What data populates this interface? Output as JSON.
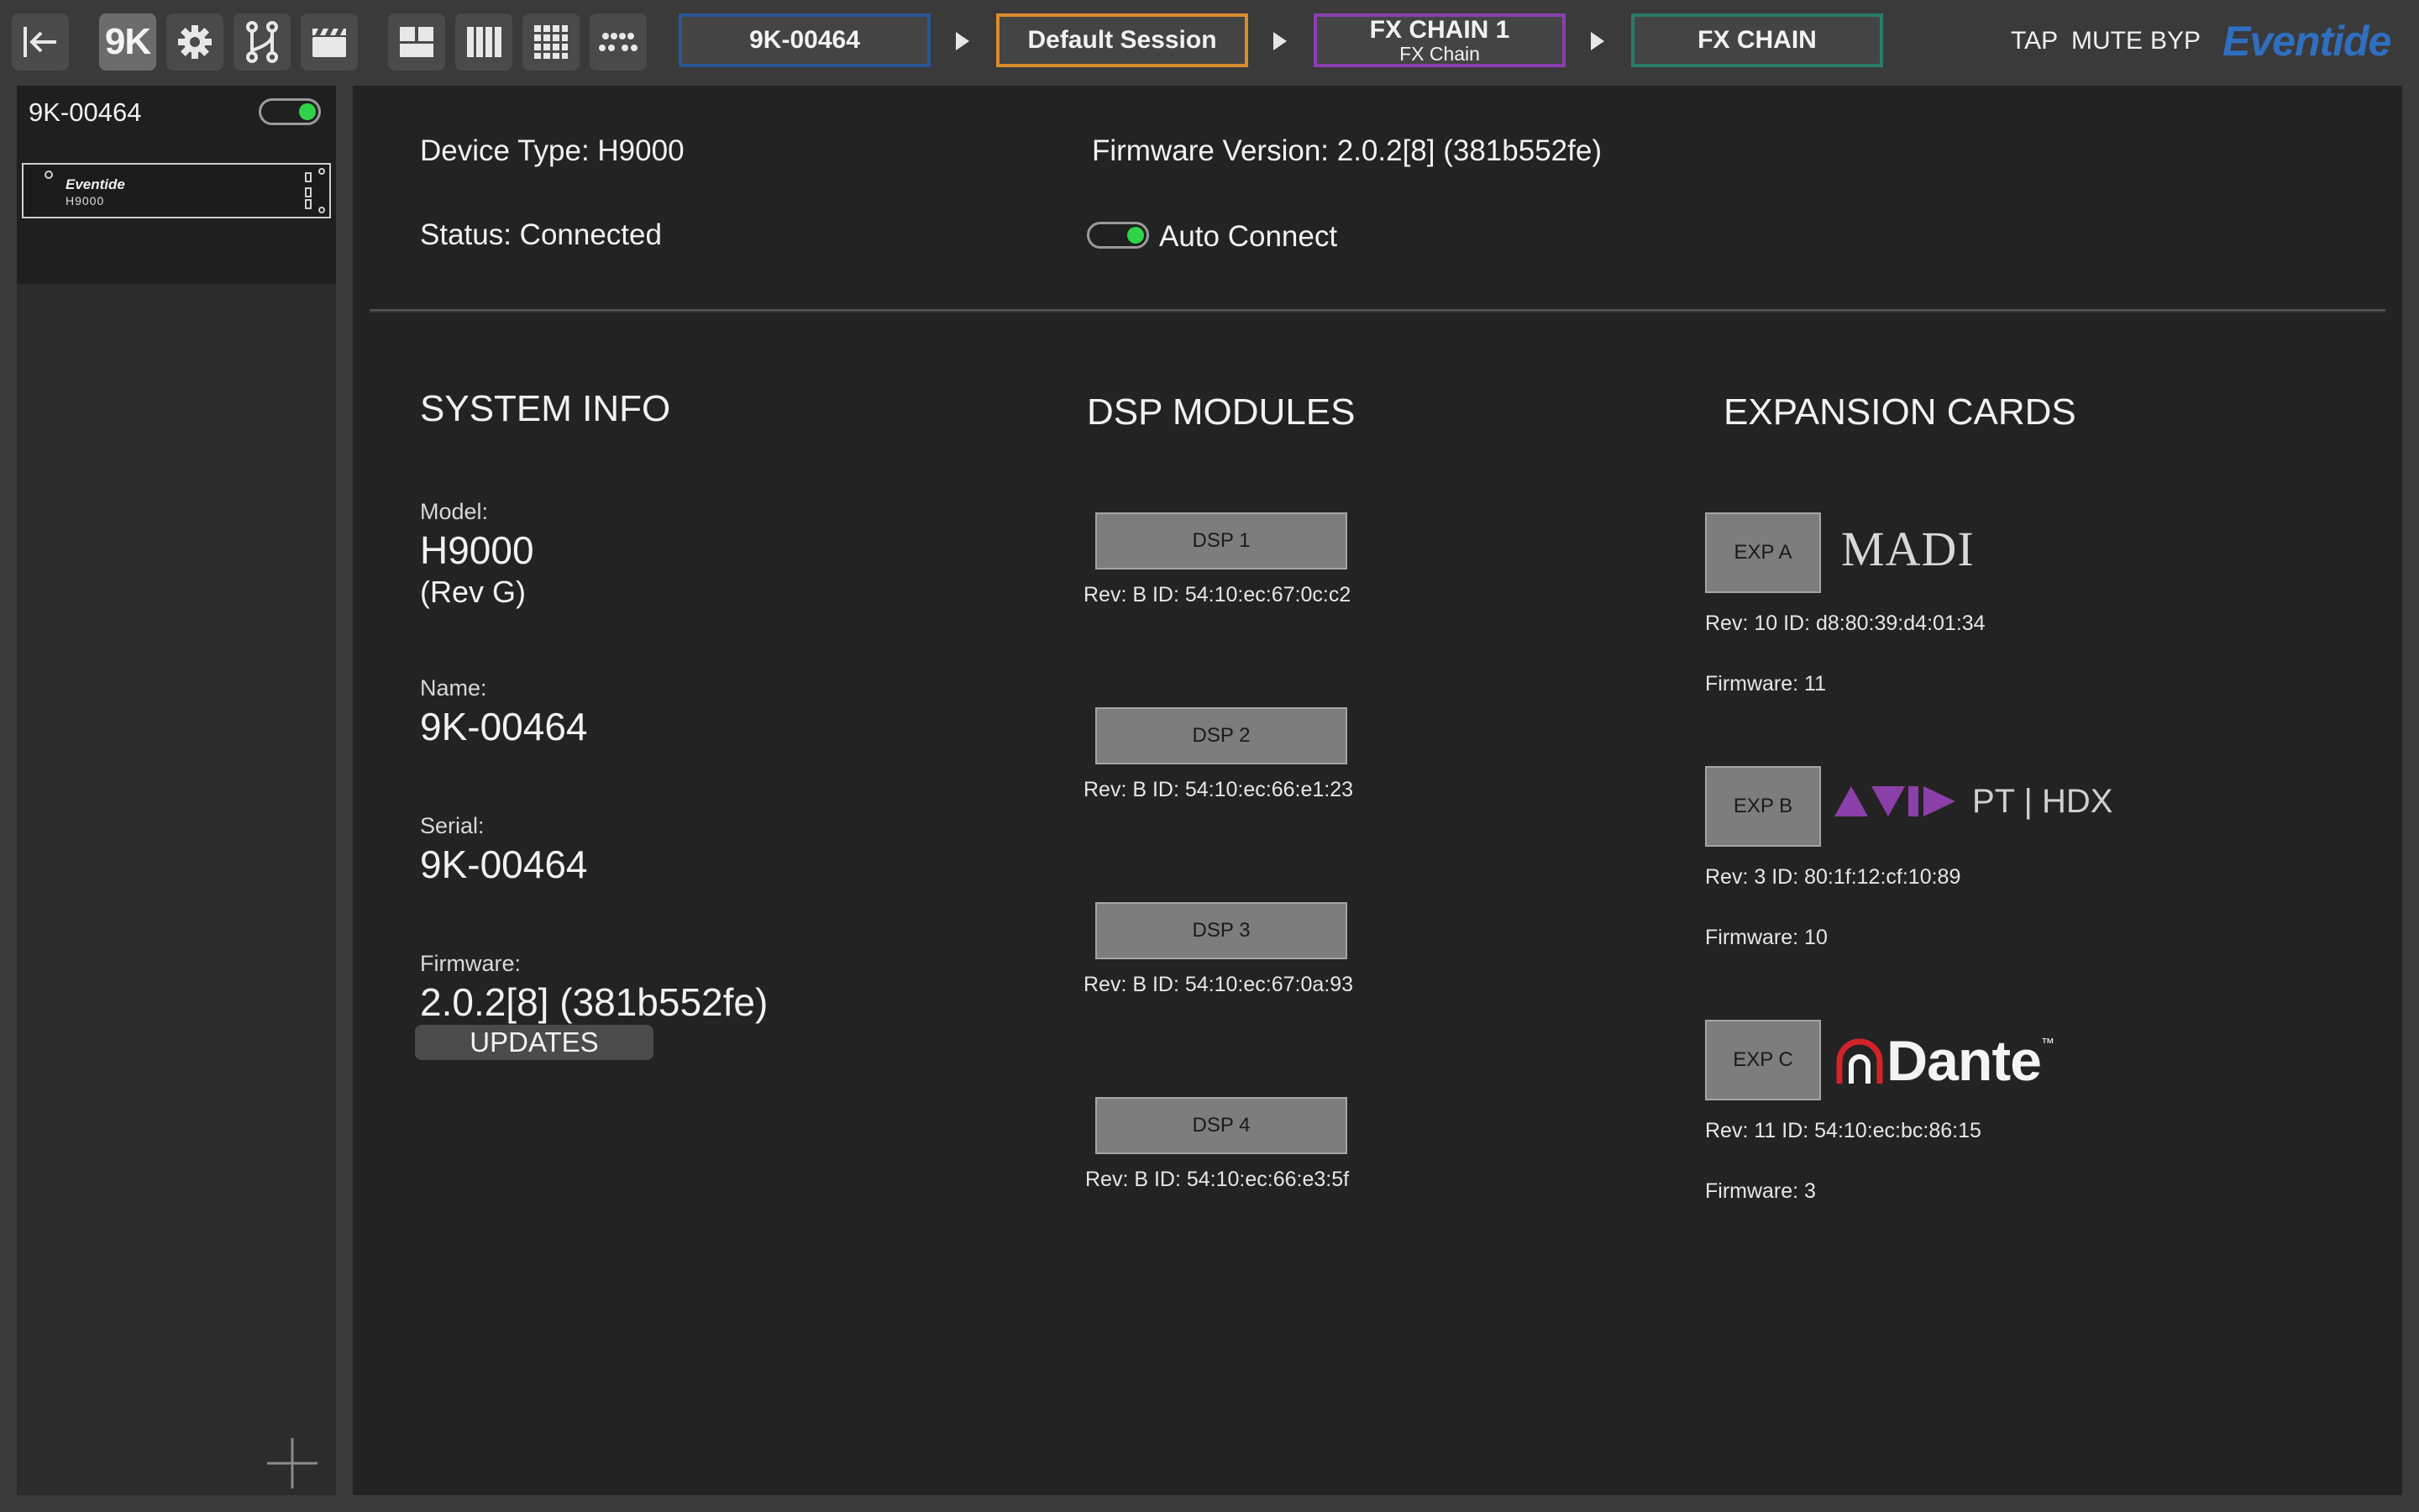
{
  "toolbar": {
    "device_label": "9K",
    "breadcrumbs": [
      {
        "title": "9K-00464",
        "sub": "",
        "color": "#2a5596"
      },
      {
        "title": "Default Session",
        "sub": "",
        "color": "#d98c2b"
      },
      {
        "title": "FX CHAIN 1",
        "sub": "FX Chain",
        "color": "#8a3fb0"
      },
      {
        "title": "FX CHAIN",
        "sub": "",
        "color": "#2a7a6a"
      }
    ],
    "tap": "TAP",
    "mute": "MUTE",
    "byp": "BYP",
    "brand": "Eventide"
  },
  "sidebar": {
    "device_name": "9K-00464",
    "connected": true,
    "thumb_brand": "Eventide",
    "thumb_model": "H9000"
  },
  "device": {
    "type_line": "Device Type: H9000",
    "firmware_line": "Firmware Version: 2.0.2[8] (381b552fe)",
    "status_line": "Status: Connected",
    "auto_connect_label": "Auto Connect",
    "auto_connect": true
  },
  "system_info": {
    "heading": "SYSTEM INFO",
    "model_label": "Model:",
    "model_value": "H9000",
    "model_rev": "(Rev G)",
    "name_label": "Name:",
    "name_value": "9K-00464",
    "serial_label": "Serial:",
    "serial_value": "9K-00464",
    "firmware_label": "Firmware:",
    "firmware_value": "2.0.2[8] (381b552fe)",
    "updates_button": "UPDATES"
  },
  "dsp_modules": {
    "heading": "DSP MODULES",
    "modules": [
      {
        "label": "DSP 1",
        "info": "Rev: B ID: 54:10:ec:67:0c:c2"
      },
      {
        "label": "DSP 2",
        "info": "Rev: B ID: 54:10:ec:66:e1:23"
      },
      {
        "label": "DSP 3",
        "info": "Rev: B ID: 54:10:ec:67:0a:93"
      },
      {
        "label": "DSP 4",
        "info": "Rev: B ID: 54:10:ec:66:e3:5f"
      }
    ]
  },
  "expansion_cards": {
    "heading": "EXPANSION CARDS",
    "cards": [
      {
        "label": "EXP A",
        "logo": "MADI",
        "info": "Rev: 10 ID: d8:80:39:d4:01:34",
        "firmware": "Firmware: 11"
      },
      {
        "label": "EXP B",
        "logo": "PT | HDX",
        "info": "Rev: 3 ID: 80:1f:12:cf:10:89",
        "firmware": "Firmware: 10"
      },
      {
        "label": "EXP C",
        "logo": "Dante",
        "logo_mark": "™",
        "info": "Rev: 11 ID: 54:10:ec:bc:86:15",
        "firmware": "Firmware: 3"
      }
    ]
  },
  "colors": {
    "brand_blue": "#2f6fc0",
    "toggle_on": "#2fd34a",
    "avid_purple": "#8b3fa8",
    "dante_red": "#d2232a"
  }
}
